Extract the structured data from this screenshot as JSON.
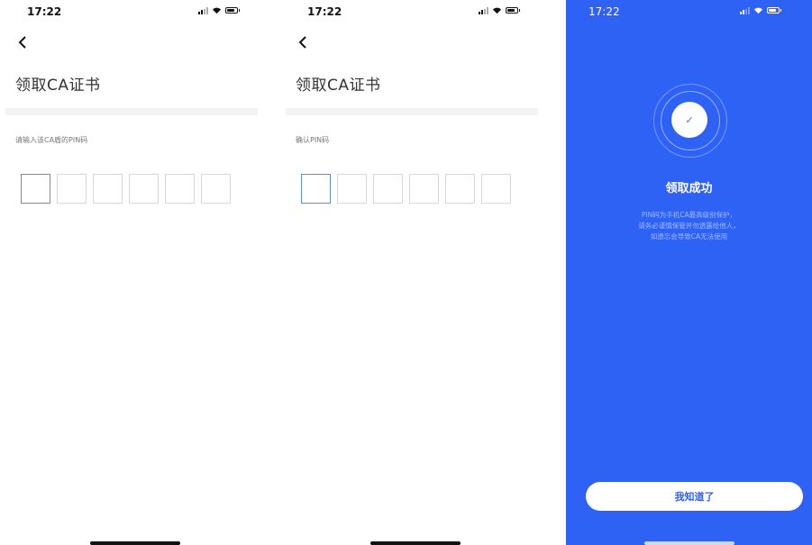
{
  "status": {
    "time": "17:22"
  },
  "header": {
    "title": "领取CA证书"
  },
  "screen1": {
    "label": "请输入该CA盾的PIN码"
  },
  "screen2": {
    "label": "确认PIN码"
  },
  "pin_count": 6,
  "success": {
    "title": "领取成功",
    "desc_lines": [
      "PIN码为手机CA最高级别保护，",
      "请务必谨慎保管并勿透露给他人，",
      "如遗忘会导致CA无法使用"
    ],
    "button_label": "我知道了"
  },
  "colors": {
    "primary": "#2e62f5",
    "active_pin_border": "#5b8de3"
  },
  "icons": [
    "signal-icon",
    "wifi-icon",
    "battery-icon",
    "back-arrow-icon",
    "checkmark-icon"
  ]
}
